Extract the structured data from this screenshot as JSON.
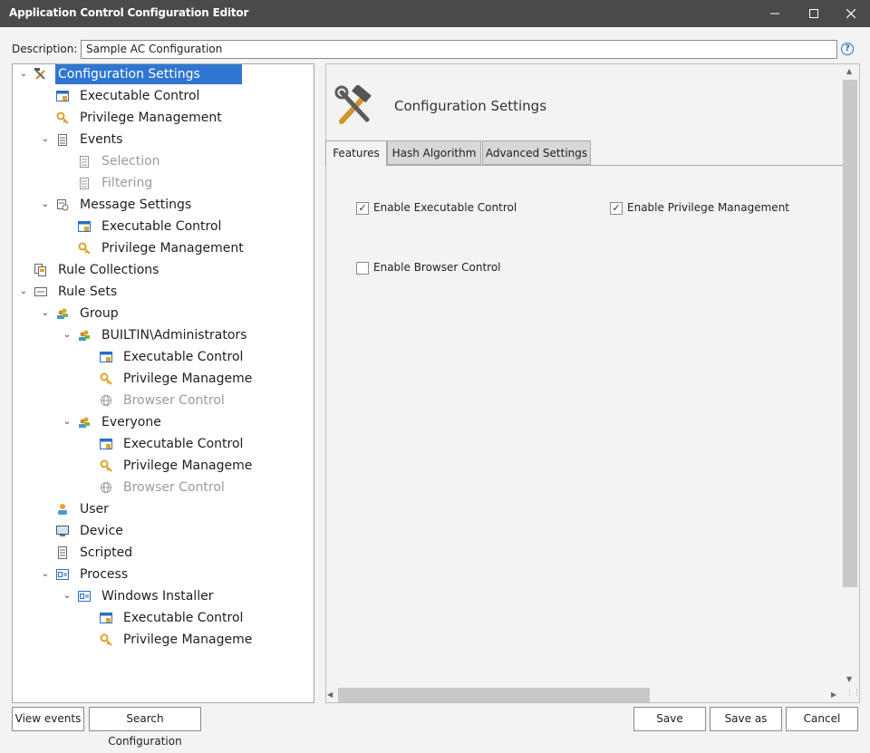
{
  "window": {
    "title": "Application Control Configuration Editor"
  },
  "description": {
    "label": "Description:",
    "value": "Sample AC Configuration"
  },
  "tree": {
    "items": [
      {
        "label": "Configuration Settings",
        "icon": "tools-icon",
        "selected": true
      },
      {
        "label": "Executable Control",
        "icon": "executable-icon"
      },
      {
        "label": "Privilege Management",
        "icon": "key-icon"
      },
      {
        "label": "Events",
        "icon": "clipboard-icon"
      },
      {
        "label": "Selection",
        "icon": "clipboard-icon",
        "disabled": true
      },
      {
        "label": "Filtering",
        "icon": "clipboard-icon",
        "disabled": true
      },
      {
        "label": "Message Settings",
        "icon": "message-settings-icon"
      },
      {
        "label": "Executable Control",
        "icon": "executable-icon"
      },
      {
        "label": "Privilege Management",
        "icon": "key-icon"
      },
      {
        "label": "Rule Collections",
        "icon": "rule-collections-icon"
      },
      {
        "label": "Rule Sets",
        "icon": "rule-sets-icon"
      },
      {
        "label": "Group",
        "icon": "group-icon"
      },
      {
        "label": "BUILTIN\\Administrators",
        "icon": "group-icon"
      },
      {
        "label": "Executable Control",
        "icon": "executable-icon"
      },
      {
        "label": "Privilege Manageme",
        "icon": "key-icon"
      },
      {
        "label": "Browser Control",
        "icon": "globe-icon",
        "disabled": true
      },
      {
        "label": "Everyone",
        "icon": "group-icon"
      },
      {
        "label": "Executable Control",
        "icon": "executable-icon"
      },
      {
        "label": "Privilege Manageme",
        "icon": "key-icon"
      },
      {
        "label": "Browser Control",
        "icon": "globe-icon",
        "disabled": true
      },
      {
        "label": "User",
        "icon": "user-icon"
      },
      {
        "label": "Device",
        "icon": "monitor-icon"
      },
      {
        "label": "Scripted",
        "icon": "script-icon"
      },
      {
        "label": "Process",
        "icon": "process-icon"
      },
      {
        "label": "Windows Installer",
        "icon": "process-icon"
      },
      {
        "label": "Executable Control",
        "icon": "executable-icon"
      },
      {
        "label": "Privilege Manageme",
        "icon": "key-icon"
      }
    ]
  },
  "panel": {
    "heading": "Configuration Settings",
    "heading_icon": "tools-icon",
    "tabs": [
      "Features",
      "Hash Algorithm",
      "Advanced Settings"
    ],
    "active_tab": "Features",
    "features": {
      "executable_control": {
        "label": "Enable Executable Control",
        "checked": true
      },
      "privilege_management": {
        "label": "Enable Privilege Management",
        "checked": true
      },
      "browser_control": {
        "label": "Enable Browser Control",
        "checked": false
      }
    }
  },
  "footer": {
    "view_events": "View events",
    "search_configuration": "Search Configuration",
    "save": "Save",
    "save_as": "Save as",
    "cancel": "Cancel"
  },
  "colors": {
    "titlebar": "#4a4a4a",
    "selection": "#2f76d0",
    "icon_orange": "#e0a32b",
    "icon_blue": "#2a6fc2"
  }
}
